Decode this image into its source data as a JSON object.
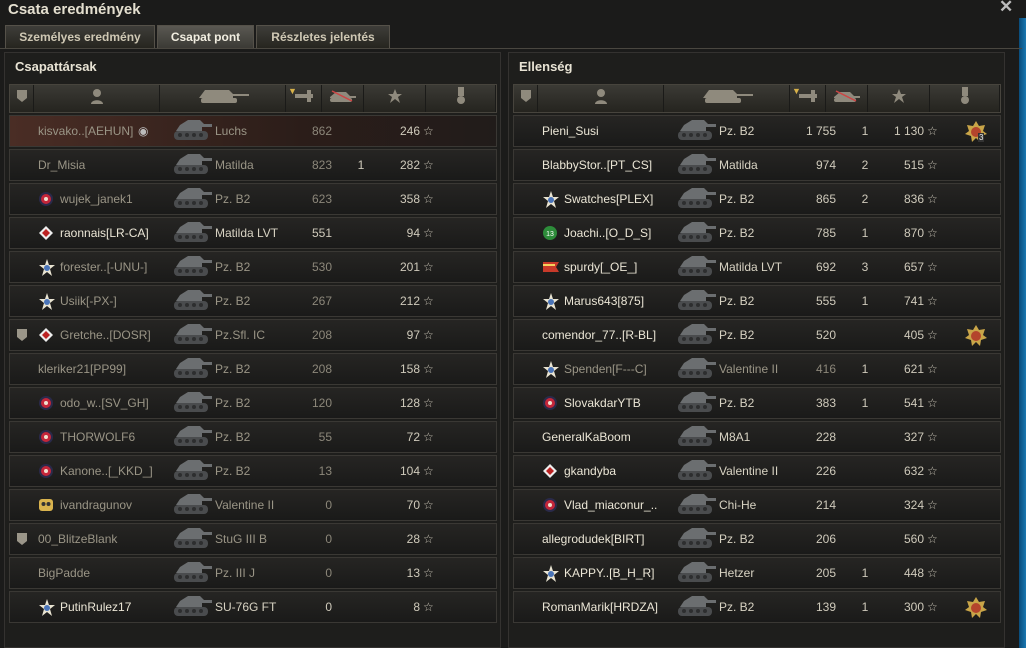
{
  "window": {
    "title": "Csata eredmények",
    "close_glyph": "✕"
  },
  "tabs": [
    {
      "label": "Személyes eredmény",
      "active": false
    },
    {
      "label": "Csapat pont",
      "active": true
    },
    {
      "label": "Részletes jelentés",
      "active": false
    }
  ],
  "columns_icons": [
    "platoon-icon",
    "player-icon",
    "tank-icon",
    "damage-icon",
    "kills-icon",
    "xp-star-icon",
    "medal-icon"
  ],
  "colors": {
    "accent_row": "#4a2d25",
    "text_dim": "#9a9586",
    "text_main": "#cfcabb"
  },
  "allies": {
    "title": "Csapattársak",
    "rows": [
      {
        "name": "kisvako..[AEHUN]",
        "tank": "Luchs",
        "dmg": "862",
        "kills": "",
        "xp": "246",
        "clan": "none",
        "dim": true,
        "me": true,
        "hidden_icon": true
      },
      {
        "name": "Dr_Misia",
        "tank": "Matilda",
        "dmg": "823",
        "kills": "1",
        "xp": "282",
        "clan": "none",
        "dim": true
      },
      {
        "name": "wujek_janek1",
        "tank": "Pz. B2",
        "dmg": "623",
        "kills": "",
        "xp": "358",
        "clan": "red",
        "dim": true
      },
      {
        "name": "raonnais[LR-CA]",
        "tank": "Matilda LVT",
        "dmg": "551",
        "kills": "",
        "xp": "94",
        "clan": "diamond",
        "dim": false
      },
      {
        "name": "forester..[-UNU-]",
        "tank": "Pz. B2",
        "dmg": "530",
        "kills": "",
        "xp": "201",
        "clan": "star",
        "dim": true
      },
      {
        "name": "Usiik[-PX-]",
        "tank": "Pz. B2",
        "dmg": "267",
        "kills": "",
        "xp": "212",
        "clan": "star",
        "dim": true
      },
      {
        "name": "Gretche..[DOSR]",
        "tank": "Pz.Sfl. IC",
        "dmg": "208",
        "kills": "",
        "xp": "97",
        "clan": "diamond",
        "dim": true,
        "platoon": true
      },
      {
        "name": "kleriker21[PP99]",
        "tank": "Pz. B2",
        "dmg": "208",
        "kills": "",
        "xp": "158",
        "clan": "none",
        "dim": true
      },
      {
        "name": "odo_w..[SV_GH]",
        "tank": "Pz. B2",
        "dmg": "120",
        "kills": "",
        "xp": "128",
        "clan": "red",
        "dim": true
      },
      {
        "name": "THORWOLF6",
        "tank": "Pz. B2",
        "dmg": "55",
        "kills": "",
        "xp": "72",
        "clan": "red",
        "dim": true
      },
      {
        "name": "Kanone..[_KKD_]",
        "tank": "Pz. B2",
        "dmg": "13",
        "kills": "",
        "xp": "104",
        "clan": "red",
        "dim": true
      },
      {
        "name": "ivandragunov",
        "tank": "Valentine II",
        "dmg": "0",
        "kills": "",
        "xp": "70",
        "clan": "skull",
        "dim": true
      },
      {
        "name": "00_BlitzeBlank",
        "tank": "StuG III B",
        "dmg": "0",
        "kills": "",
        "xp": "28",
        "clan": "none",
        "dim": true,
        "platoon": true
      },
      {
        "name": "BigPadde",
        "tank": "Pz. III J",
        "dmg": "0",
        "kills": "",
        "xp": "13",
        "clan": "none",
        "dim": true
      },
      {
        "name": "PutinRulez17",
        "tank": "SU-76G FT",
        "dmg": "0",
        "kills": "",
        "xp": "8",
        "clan": "star",
        "dim": false
      }
    ]
  },
  "enemies": {
    "title": "Ellenség",
    "rows": [
      {
        "name": "Pieni_Susi",
        "tank": "Pz. B2",
        "dmg": "1 755",
        "kills": "1",
        "xp": "1 130",
        "clan": "none",
        "dim": false,
        "medal": "3"
      },
      {
        "name": "BlabbyStor..[PT_CS]",
        "tank": "Matilda",
        "dmg": "974",
        "kills": "2",
        "xp": "515",
        "clan": "none",
        "dim": false
      },
      {
        "name": "Swatches[PLEX]",
        "tank": "Pz. B2",
        "dmg": "865",
        "kills": "2",
        "xp": "836",
        "clan": "star",
        "dim": false
      },
      {
        "name": "Joachi..[O_D_S]",
        "tank": "Pz. B2",
        "dmg": "785",
        "kills": "1",
        "xp": "870",
        "clan": "green",
        "dim": false
      },
      {
        "name": "spurdy[_OE_]",
        "tank": "Matilda LVT",
        "dmg": "692",
        "kills": "3",
        "xp": "657",
        "clan": "flag",
        "dim": false
      },
      {
        "name": "Marus643[875]",
        "tank": "Pz. B2",
        "dmg": "555",
        "kills": "1",
        "xp": "741",
        "clan": "star",
        "dim": false
      },
      {
        "name": "comendor_77..[R-BL]",
        "tank": "Pz. B2",
        "dmg": "520",
        "kills": "",
        "xp": "405",
        "clan": "none",
        "dim": false,
        "medal": ""
      },
      {
        "name": "Spenden[F---C]",
        "tank": "Valentine II",
        "dmg": "416",
        "kills": "1",
        "xp": "621",
        "clan": "star",
        "dim": true
      },
      {
        "name": "SlovakdarYTB",
        "tank": "Pz. B2",
        "dmg": "383",
        "kills": "1",
        "xp": "541",
        "clan": "red",
        "dim": false
      },
      {
        "name": "GeneralKaBoom",
        "tank": "M8A1",
        "dmg": "228",
        "kills": "",
        "xp": "327",
        "clan": "none",
        "dim": false
      },
      {
        "name": "gkandyba",
        "tank": "Valentine II",
        "dmg": "226",
        "kills": "",
        "xp": "632",
        "clan": "diamond",
        "dim": false
      },
      {
        "name": "Vlad_miaconur_..",
        "tank": "Chi-He",
        "dmg": "214",
        "kills": "",
        "xp": "324",
        "clan": "red",
        "dim": false
      },
      {
        "name": "allegrodudek[BIRT]",
        "tank": "Pz. B2",
        "dmg": "206",
        "kills": "",
        "xp": "560",
        "clan": "none",
        "dim": false
      },
      {
        "name": "KAPPY..[B_H_R]",
        "tank": "Hetzer",
        "dmg": "205",
        "kills": "1",
        "xp": "448",
        "clan": "star",
        "dim": false
      },
      {
        "name": "RomanMarik[HRDZA]",
        "tank": "Pz. B2",
        "dmg": "139",
        "kills": "1",
        "xp": "300",
        "clan": "none",
        "dim": false,
        "medal": ""
      }
    ]
  }
}
